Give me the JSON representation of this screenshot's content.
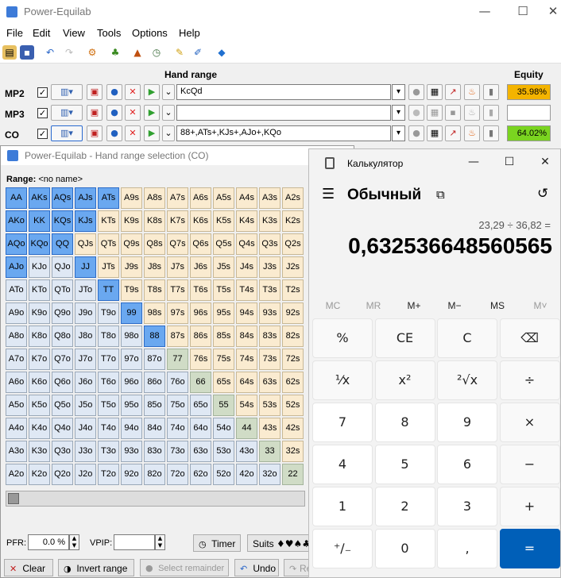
{
  "main_window": {
    "title": "Power-Equilab",
    "controls": {
      "minimize": "—",
      "maximize": "☐",
      "close": "✕"
    }
  },
  "menu": {
    "file": "File",
    "edit": "Edit",
    "view": "View",
    "tools": "Tools",
    "options": "Options",
    "help": "Help"
  },
  "headers": {
    "hand_range": "Hand range",
    "equity": "Equity"
  },
  "players": [
    {
      "label": "MP2",
      "checked": true,
      "range": "KcQd",
      "equity": "35.98%",
      "equity_color": "#f4b400"
    },
    {
      "label": "MP3",
      "checked": true,
      "range": "",
      "equity": "",
      "equity_color": "#ffffff"
    },
    {
      "label": "CO",
      "checked": true,
      "range": "88+,ATs+,KJs+,AJo+,KQo",
      "equity": "64.02%",
      "equity_color": "#7ad420"
    }
  ],
  "hand_range_window": {
    "title": "Power-Equilab - Hand range selection (CO)",
    "range_label": "Range:",
    "range_name": "<no name>",
    "ranks": [
      "A",
      "K",
      "Q",
      "J",
      "T",
      "9",
      "8",
      "7",
      "6",
      "5",
      "4",
      "3",
      "2"
    ],
    "selected": [
      "AA",
      "AKs",
      "AQs",
      "AJs",
      "ATs",
      "AKo",
      "KK",
      "KQs",
      "KJs",
      "AQo",
      "KQo",
      "QQ",
      "AJo",
      "JJ",
      "TT",
      "99",
      "88"
    ],
    "pfr_label": "PFR:",
    "pfr_value": "0.0 %",
    "vpip_label": "VPIP:",
    "vpip_value": "",
    "timer_label": "Timer",
    "suits_label": "Suits",
    "suit_glyphs": "♦♥♠♣",
    "clear_label": "Clear",
    "invert_label": "Invert range",
    "select_remainder_label": "Select remainder",
    "undo_label": "Undo",
    "redo_label": "Re"
  },
  "calculator": {
    "title": "Калькулятор",
    "mode": "Обычный",
    "expression": "23,29 ÷ 36,82 =",
    "display": "0,632536648560565",
    "memory": [
      "MC",
      "MR",
      "M+",
      "M−",
      "MS",
      "M˅"
    ],
    "keys": [
      [
        "%",
        "CE",
        "C",
        "⌫"
      ],
      [
        "¹⁄x",
        "x²",
        "²√x",
        "÷"
      ],
      [
        "7",
        "8",
        "9",
        "×"
      ],
      [
        "4",
        "5",
        "6",
        "−"
      ],
      [
        "1",
        "2",
        "3",
        "+"
      ],
      [
        "⁺∕₋",
        "0",
        ",",
        "="
      ]
    ]
  }
}
